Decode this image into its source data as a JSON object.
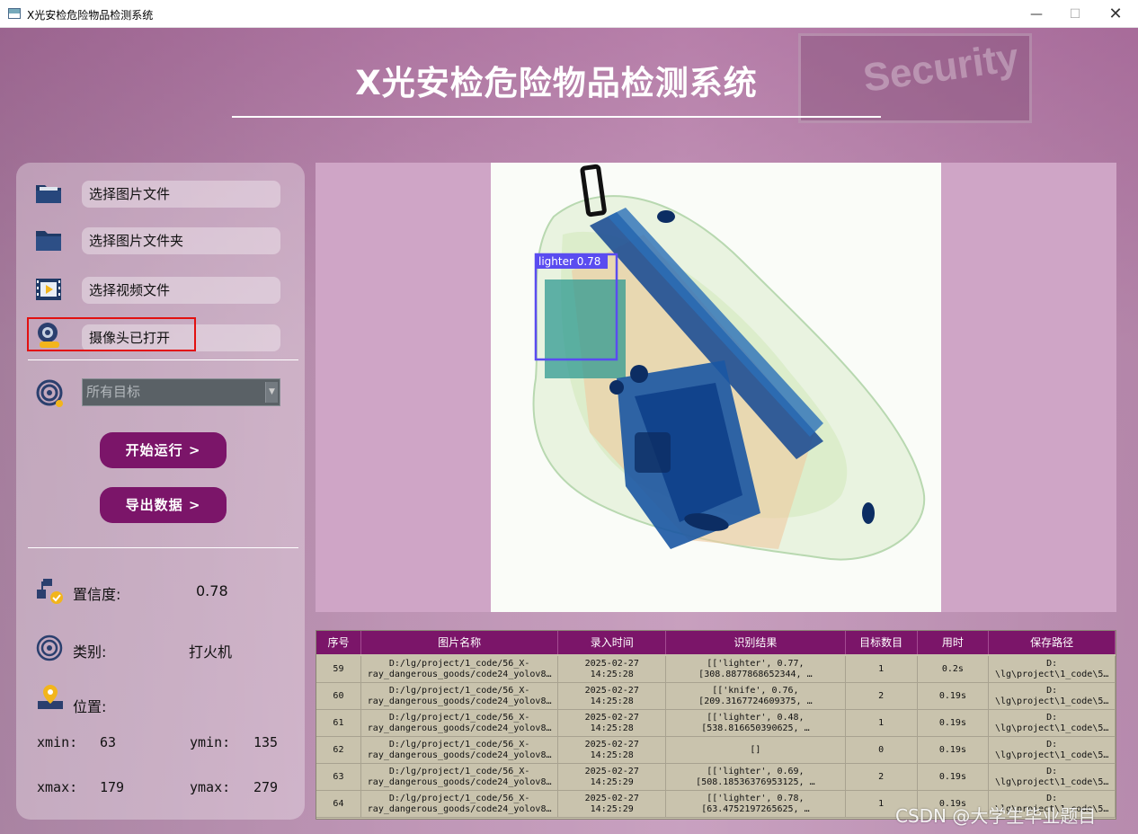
{
  "window": {
    "title": "X光安检危险物品检测系统",
    "min": "—",
    "max": "☐",
    "close": "✕"
  },
  "header": {
    "title": "X光安检危险物品检测系统"
  },
  "background": {
    "sign_text": "Security"
  },
  "sidebar": {
    "buttons": [
      {
        "label": "选择图片文件",
        "icon": "image-folder-icon"
      },
      {
        "label": "选择图片文件夹",
        "icon": "folder-icon"
      },
      {
        "label": "选择视频文件",
        "icon": "video-file-icon"
      },
      {
        "label": "摄像头已打开",
        "icon": "camera-icon"
      }
    ],
    "target_select": {
      "value": "所有目标",
      "icon": "target-icon"
    },
    "start_button": "开始运行 >",
    "export_button": "导出数据 >",
    "info": {
      "confidence_label": "置信度:",
      "confidence_value": "0.78",
      "class_label": "类别:",
      "class_value": "打火机",
      "position_label": "位置:",
      "xmin_label": "xmin:",
      "xmin_value": "63",
      "ymin_label": "ymin:",
      "ymin_value": "135",
      "xmax_label": "xmax:",
      "xmax_value": "179",
      "ymax_label": "ymax:",
      "ymax_value": "279"
    }
  },
  "detection": {
    "label": "lighter 0.78"
  },
  "table": {
    "headers": [
      "序号",
      "图片名称",
      "录入时间",
      "识别结果",
      "目标数目",
      "用时",
      "保存路径"
    ],
    "rows": [
      [
        "59",
        "D:/lg/project/1_code/56_X-\nray_dangerous_goods/code24_yolov8…",
        "2025-02-27\n14:25:28",
        "[['lighter', 0.77,\n[308.8877868652344, …",
        "1",
        "0.2s",
        "D:\n\\lg\\project\\1_code\\5…"
      ],
      [
        "60",
        "D:/lg/project/1_code/56_X-\nray_dangerous_goods/code24_yolov8…",
        "2025-02-27\n14:25:28",
        "[['knife', 0.76,\n[209.3167724609375, …",
        "2",
        "0.19s",
        "D:\n\\lg\\project\\1_code\\5…"
      ],
      [
        "61",
        "D:/lg/project/1_code/56_X-\nray_dangerous_goods/code24_yolov8…",
        "2025-02-27\n14:25:28",
        "[['lighter', 0.48,\n[538.816650390625, …",
        "1",
        "0.19s",
        "D:\n\\lg\\project\\1_code\\5…"
      ],
      [
        "62",
        "D:/lg/project/1_code/56_X-\nray_dangerous_goods/code24_yolov8…",
        "2025-02-27\n14:25:28",
        "[]",
        "0",
        "0.19s",
        "D:\n\\lg\\project\\1_code\\5…"
      ],
      [
        "63",
        "D:/lg/project/1_code/56_X-\nray_dangerous_goods/code24_yolov8…",
        "2025-02-27\n14:25:29",
        "[['lighter', 0.69,\n[508.18536376953125, …",
        "2",
        "0.19s",
        "D:\n\\lg\\project\\1_code\\5…"
      ],
      [
        "64",
        "D:/lg/project/1_code/56_X-\nray_dangerous_goods/code24_yolov8…",
        "2025-02-27\n14:25:29",
        "[['lighter', 0.78,\n[63.4752197265625, …",
        "1",
        "0.19s",
        "D:\n\\lg\\project\\1_code\\5…"
      ]
    ]
  },
  "watermark": "CSDN @大学生毕业题目",
  "colors": {
    "accent": "#7b1569",
    "highlight": "#e21010",
    "bbox": "#5a4cf0"
  }
}
